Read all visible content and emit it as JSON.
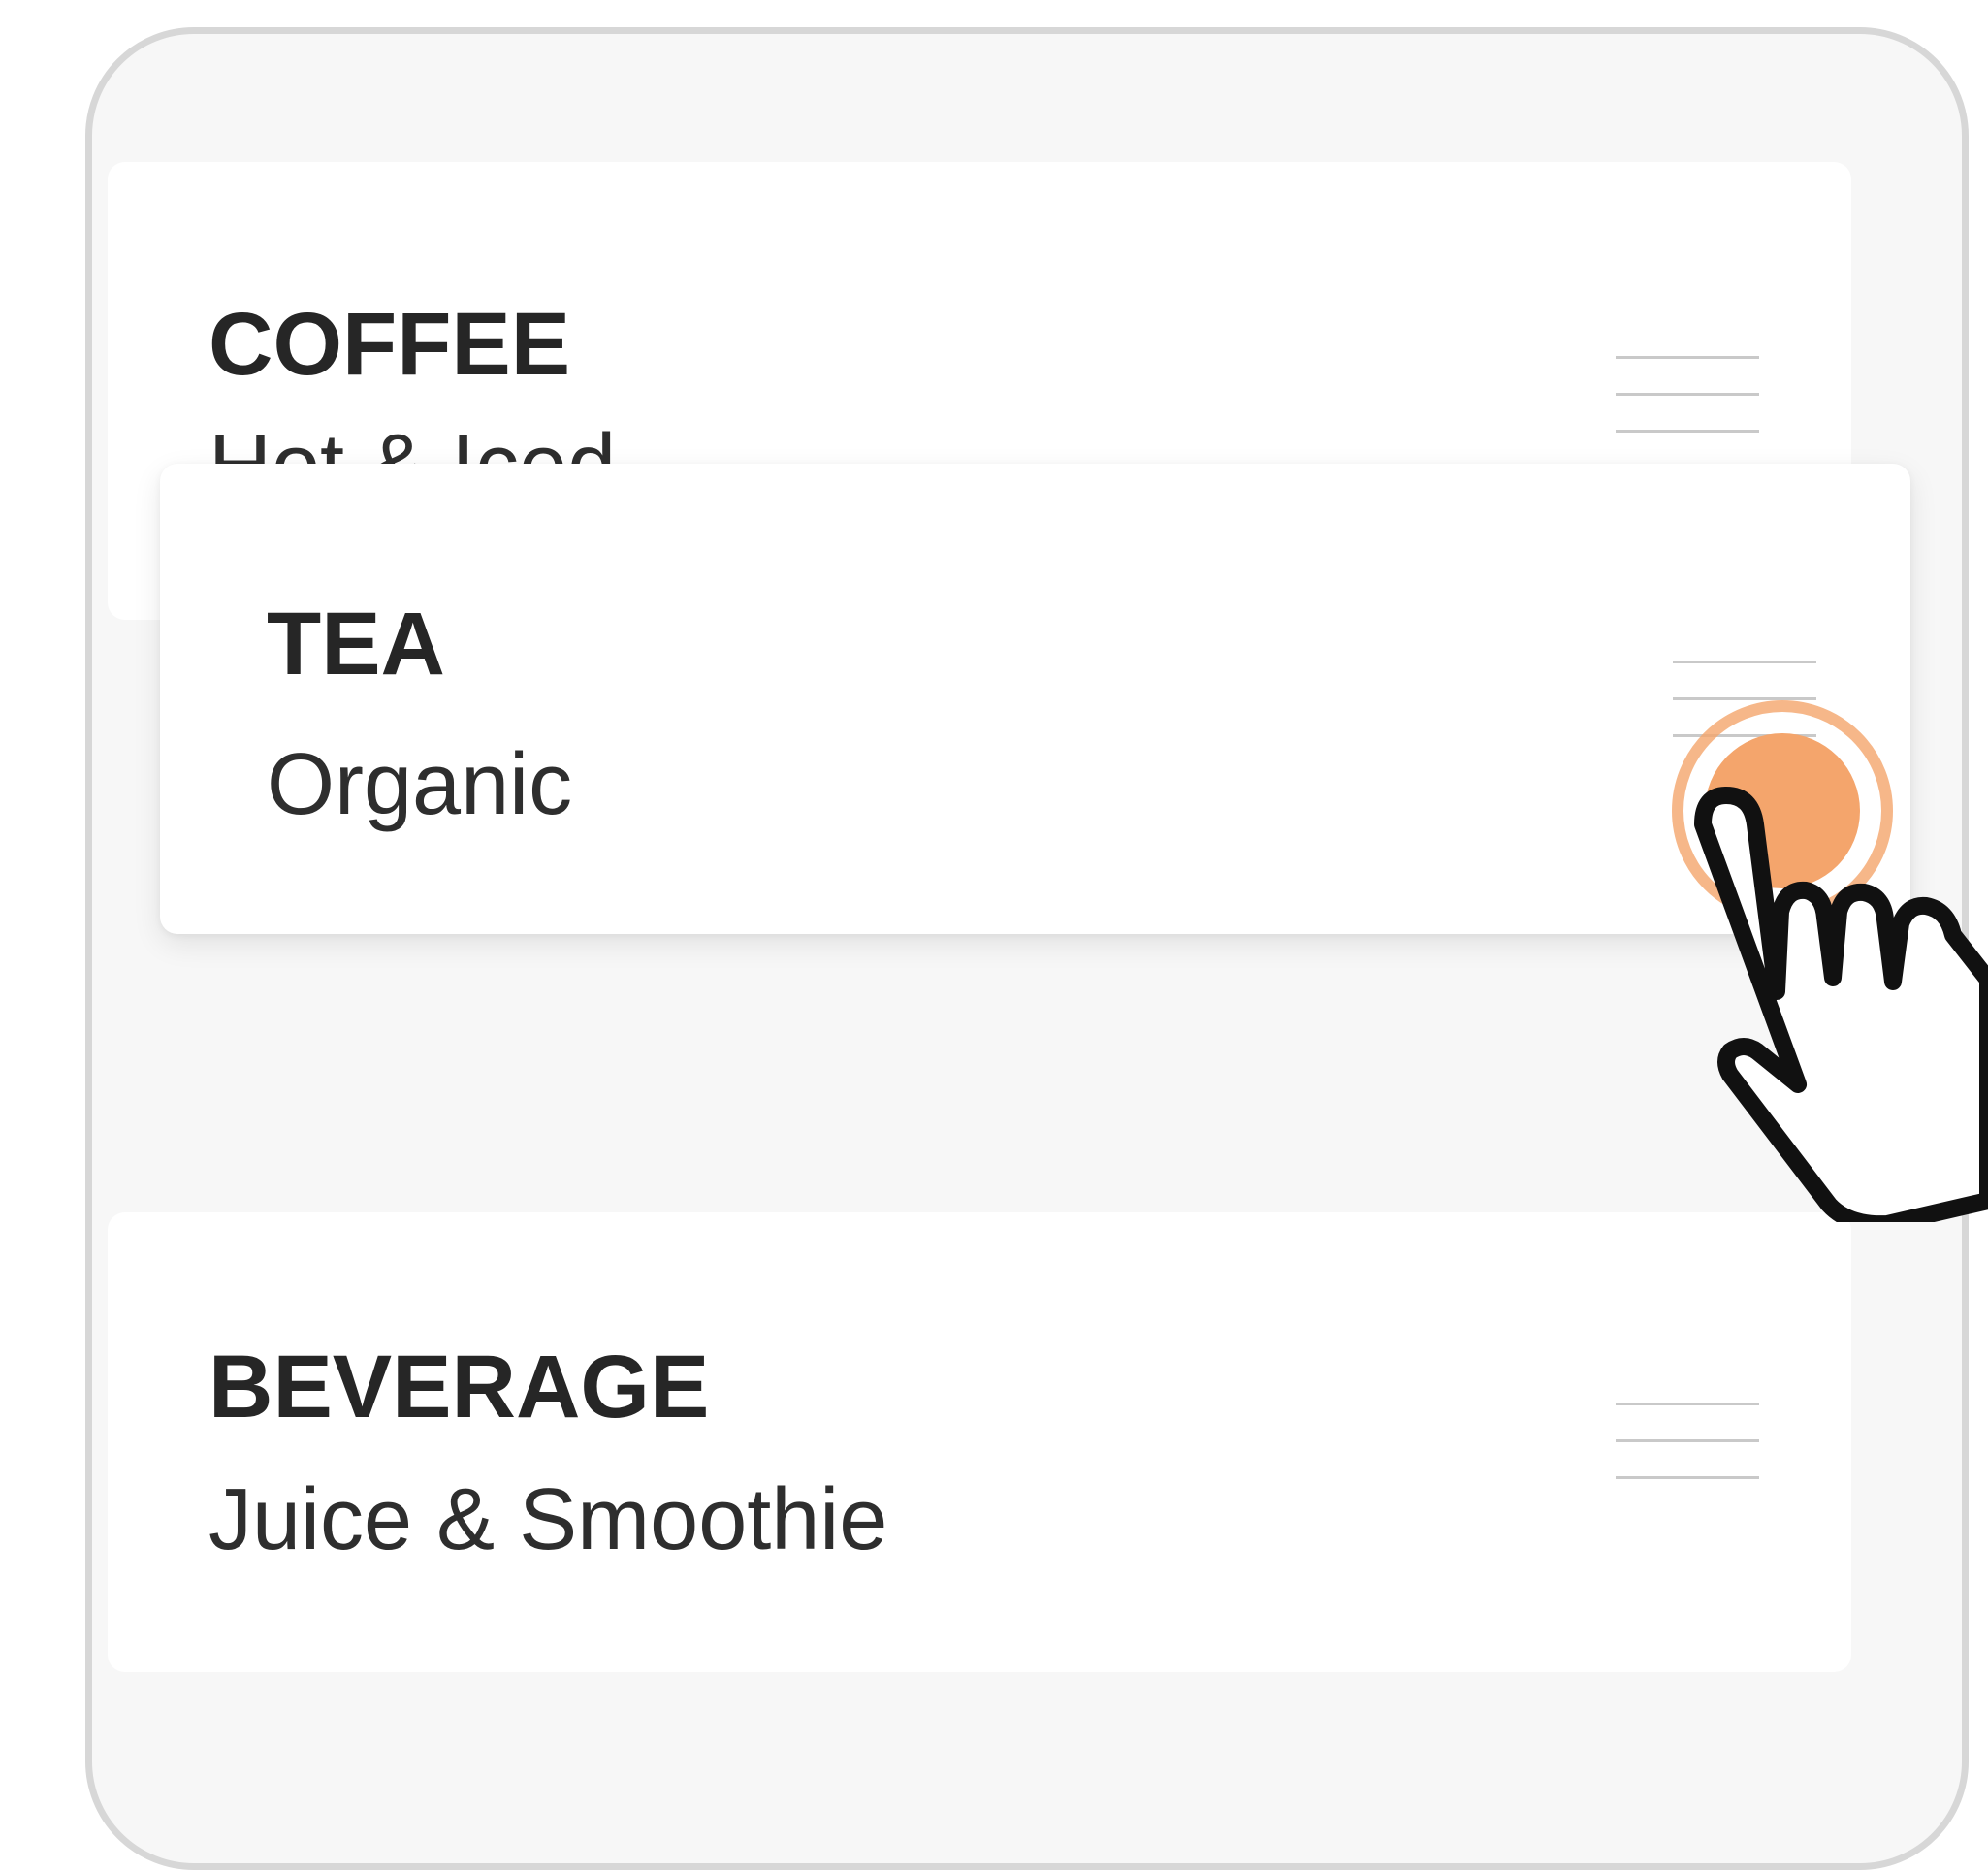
{
  "menu": {
    "items": [
      {
        "title": "COFFEE",
        "subtitle": "Hot & Iced"
      },
      {
        "title": "TEA",
        "subtitle": "Organic"
      },
      {
        "title": "BEVERAGE",
        "subtitle": "Juice & Smoothie"
      }
    ]
  },
  "drag_state": {
    "dragging_item": "TEA"
  },
  "colors": {
    "touch_accent": "#f4a56c",
    "background": "#f7f7f7",
    "card": "#ffffff"
  },
  "icons": {
    "handle": "drag-handle-icon",
    "pointer": "hand-pointer-icon"
  }
}
